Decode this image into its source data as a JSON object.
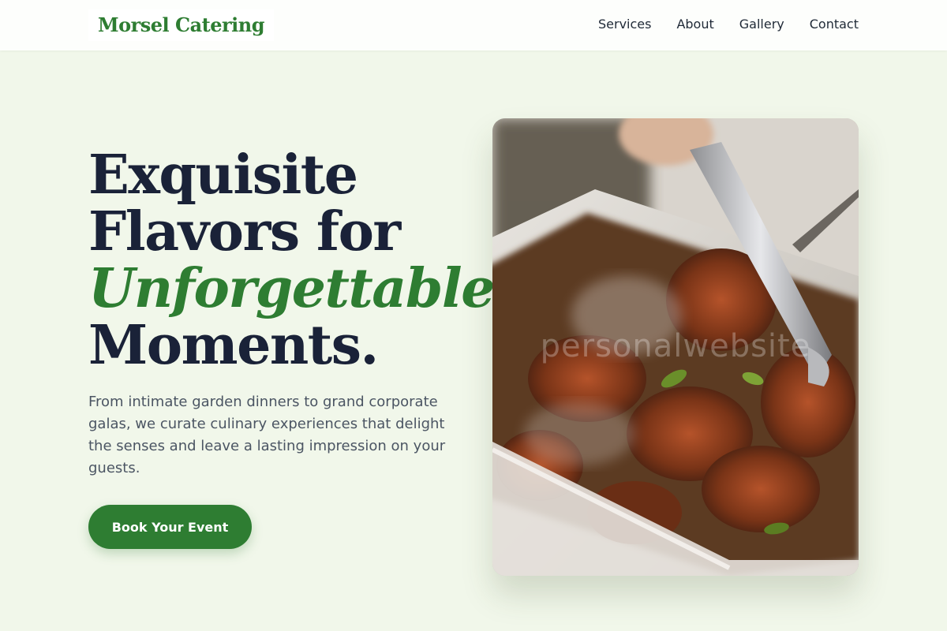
{
  "brand": {
    "name": "Morsel Catering",
    "accent_color": "#2e7d32",
    "text_color": "#1a2238",
    "background": "#f1f7ea"
  },
  "nav": {
    "items": [
      "Services",
      "About",
      "Gallery",
      "Contact"
    ]
  },
  "hero": {
    "title_line1": "Exquisite",
    "title_line2": "Flavors for",
    "title_accent": "Unforgettable",
    "title_line4": "Moments.",
    "description": "From intimate garden dinners to grand corporate galas, we curate culinary experiences that delight the senses and leave a lasting impression on your guests.",
    "cta_label": "Book Your Event",
    "image_watermark": "personalwebsite"
  }
}
